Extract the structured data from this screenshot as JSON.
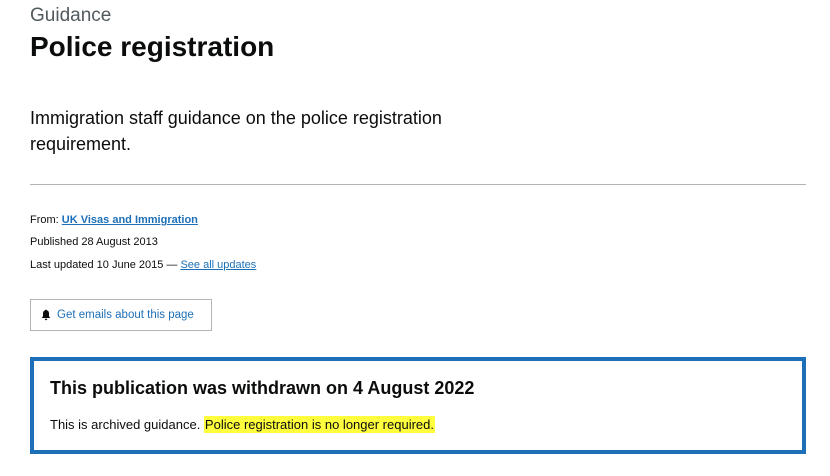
{
  "header": {
    "caption": "Guidance",
    "title": "Police registration"
  },
  "summary": "Immigration staff guidance on the police registration requirement.",
  "metadata": {
    "from_label": "From: ",
    "from_org": "UK Visas and Immigration",
    "published": "Published 28 August 2013",
    "last_updated": "Last updated 10 June 2015 — ",
    "see_all_updates": "See all updates"
  },
  "email_button": {
    "icon": "bell-icon",
    "label": "Get emails about this page"
  },
  "notice": {
    "title": "This publication was withdrawn on 4 August 2022",
    "body_text": "This is archived guidance. ",
    "highlighted_text": "Police registration is no longer required.",
    "border_color": "#1d70b8",
    "highlight_color": "#ffff3d"
  },
  "colors": {
    "link": "#1d70b8",
    "text": "#0b0c0c",
    "secondary_text": "#505a5f"
  }
}
